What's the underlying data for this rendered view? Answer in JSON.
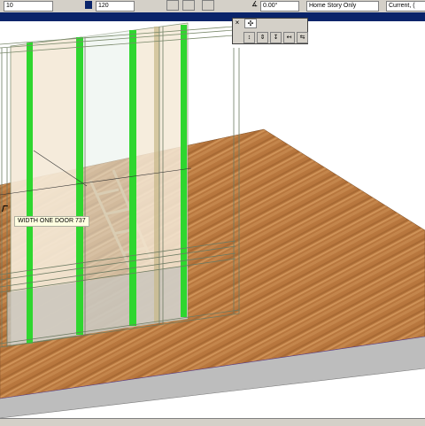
{
  "infobox": {
    "field_one": "10",
    "field_two": "120",
    "angle_value": "0.00°",
    "story_value": "Home Story Only",
    "layer_value": "Current, ("
  },
  "palette": {
    "close_glyph": "×",
    "tab_glyph": "✣",
    "tools": [
      "↕",
      "⇕",
      "↧",
      "↤",
      "⇆"
    ]
  },
  "tooltip": {
    "text": "WIDTH ONE DOOR  737"
  },
  "colors": {
    "titlebar": "#0a246a",
    "chrome": "#d4d0c8",
    "floor_wood": "#b8773e",
    "floor_side": "#bdbdbd",
    "frame_green": "#2fd62f",
    "glass_cream": "#f5ead8"
  }
}
